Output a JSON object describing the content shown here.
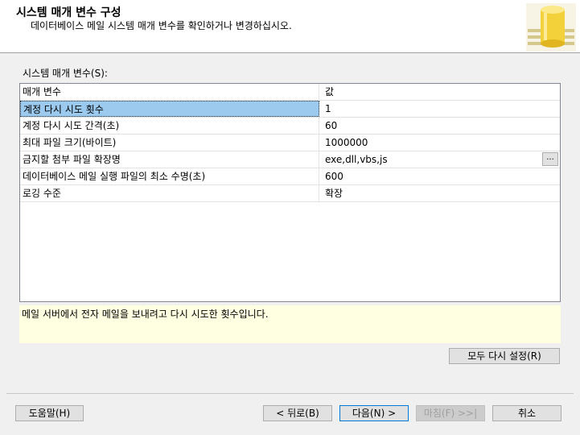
{
  "header": {
    "title": "시스템 매개 변수 구성",
    "subtitle": "데이터베이스 메일 시스템 매개 변수를 확인하거나 변경하십시오."
  },
  "section_label": "시스템 매개 변수(S):",
  "grid": {
    "columns": [
      "매개 변수",
      "값"
    ],
    "rows": [
      {
        "name": "계정 다시 시도 횟수",
        "value": "1"
      },
      {
        "name": "계정 다시 시도 간격(초)",
        "value": "60"
      },
      {
        "name": "최대 파일 크기(바이트)",
        "value": "1000000"
      },
      {
        "name": "금지할 첨부 파일 확장명",
        "value": "exe,dll,vbs,js",
        "button": "..."
      },
      {
        "name": "데이터베이스 메일 실행 파일의 최소 수명(초)",
        "value": "600"
      },
      {
        "name": "로깅 수준",
        "value": "확장"
      }
    ]
  },
  "description": "메일 서버에서 전자 메일을 보내려고 다시 시도한 횟수입니다.",
  "buttons": {
    "reset": "모두 다시 설정(R)",
    "help": "도움말(H)",
    "back": "< 뒤로(B)",
    "next": "다음(N) >",
    "finish": "마침(F) >>|",
    "cancel": "취소"
  }
}
